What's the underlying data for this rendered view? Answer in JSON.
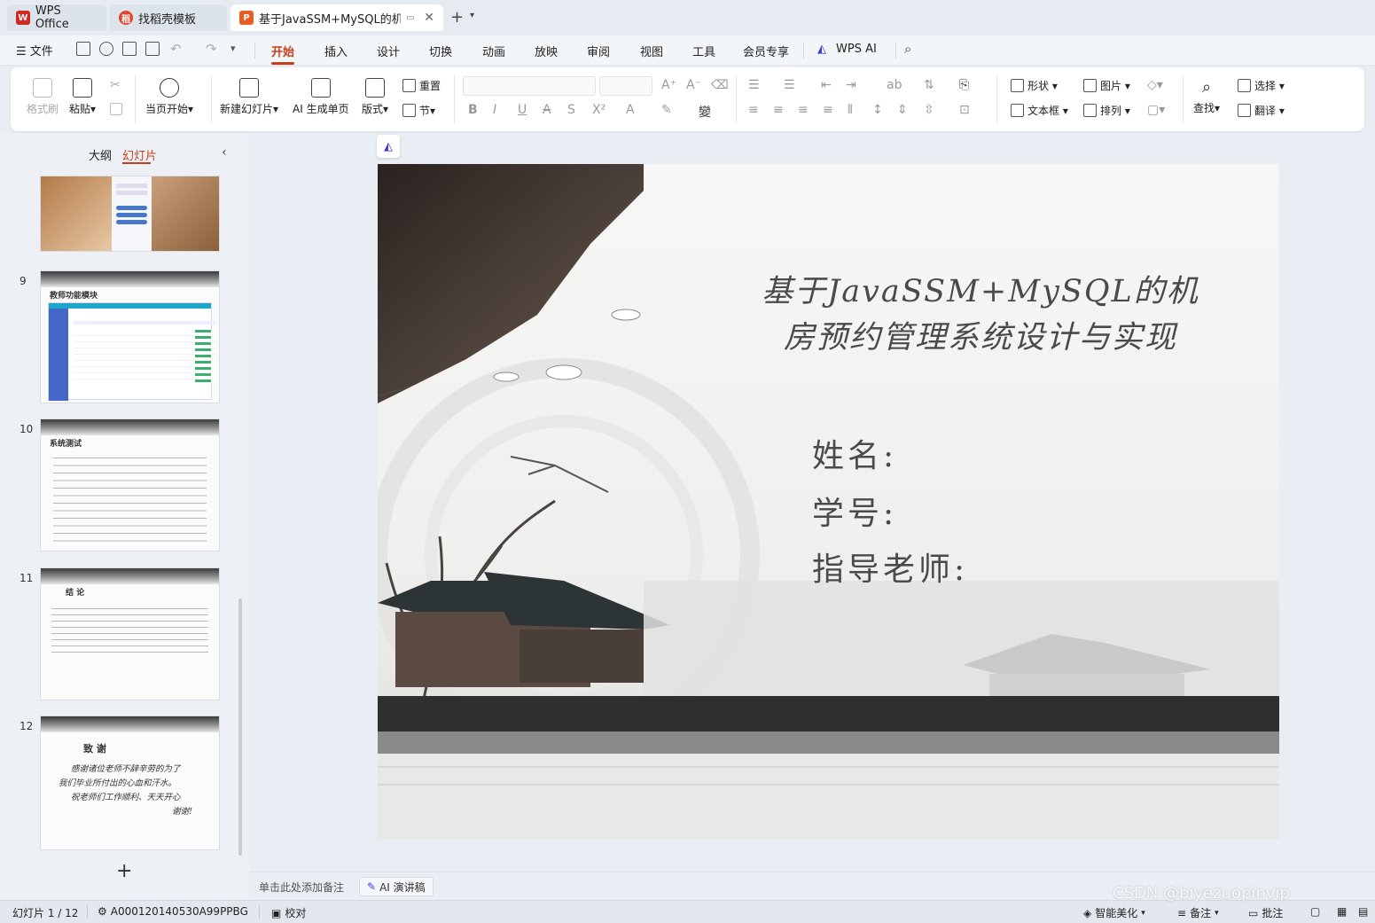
{
  "tabs": [
    {
      "label": "WPS Office",
      "icon": "wps-logo-icon"
    },
    {
      "label": "找稻壳模板",
      "icon": "docer-logo-icon"
    },
    {
      "label": "基于JavaSSM+MySQL的机房",
      "icon": "ppt-doc-icon",
      "active": true
    }
  ],
  "menu": {
    "file": "文件",
    "items": [
      "开始",
      "插入",
      "设计",
      "切换",
      "动画",
      "放映",
      "审阅",
      "视图",
      "工具",
      "会员专享",
      "WPS AI"
    ],
    "active": "开始"
  },
  "ribbon": {
    "format_painter": "格式刷",
    "paste": "粘贴",
    "play_from_current": "当页开始",
    "new_slide": "新建幻灯片",
    "ai_single": "AI 生成单页",
    "layout": "版式",
    "reset": "重置",
    "section": "节",
    "shape": "形状",
    "picture": "图片",
    "textbox": "文本框",
    "arrange": "排列",
    "find": "查找",
    "select": "选择",
    "translate": "翻译"
  },
  "left_panel": {
    "tab_outline": "大纲",
    "tab_slides": "幻灯片",
    "thumbnails": [
      {
        "num": "",
        "title": ""
      },
      {
        "num": "9",
        "title": "教师功能模块"
      },
      {
        "num": "10",
        "title": "系统测试"
      },
      {
        "num": "11",
        "title": "结  论"
      },
      {
        "num": "12",
        "title": "致  谢"
      }
    ],
    "thanks_lines": [
      "感谢诸位老师不辞辛劳的为了",
      "我们毕业所付出的心血和汗水。",
      "祝老师们工作顺利、天天开心",
      "谢谢!"
    ]
  },
  "slide": {
    "title_line1": "基于JavaSSM+MySQL的机",
    "title_line2": "房预约管理系统设计与实现",
    "field_name": "姓名:",
    "field_id": "学号:",
    "field_teacher": "指导老师:"
  },
  "notes": {
    "placeholder": "单击此处添加备注",
    "ai_speech": "AI 演讲稿"
  },
  "status": {
    "slide_counter": "幻灯片 1 / 12",
    "doc_id": "A000120140530A99PPBG",
    "proofread": "校对",
    "smart_beautify": "智能美化",
    "notes": "备注",
    "comments": "批注"
  },
  "watermark": "CSDN @biyezuopinvip",
  "colors": {
    "accent": "#c6401c",
    "ppt_orange": "#e85d22",
    "wps_red": "#d0281f"
  }
}
